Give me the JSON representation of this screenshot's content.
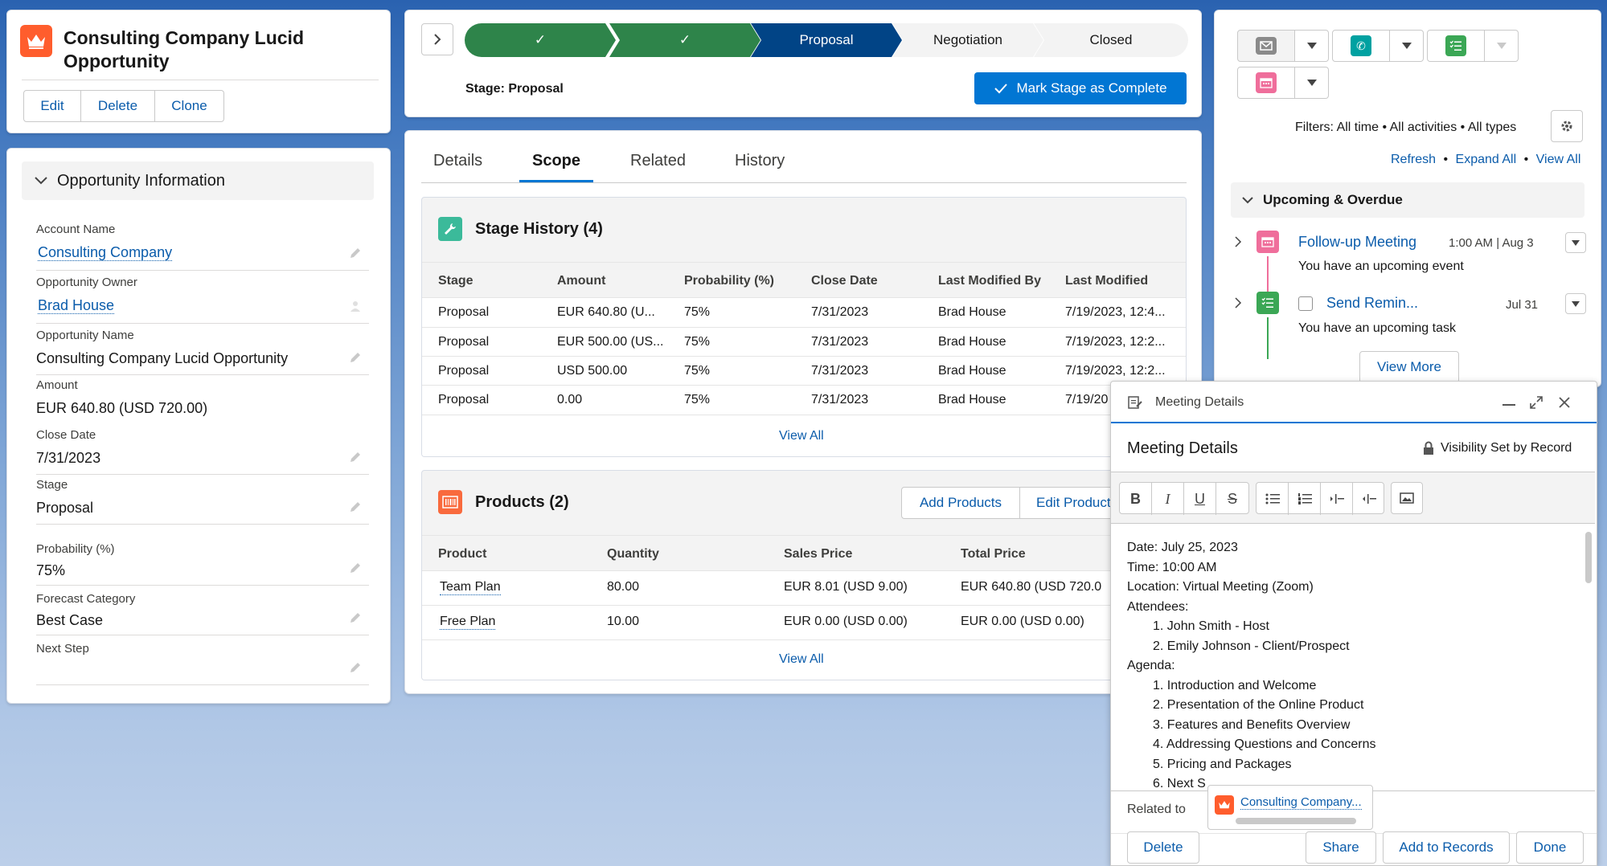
{
  "header": {
    "title_line1": "Consulting Company Lucid",
    "title_line2": "Opportunity",
    "edit": "Edit",
    "delete": "Delete",
    "clone": "Clone"
  },
  "info": {
    "section_title": "Opportunity Information",
    "fields": [
      {
        "label": "Account Name",
        "value": "Consulting Company"
      },
      {
        "label": "Opportunity Owner",
        "value": "Brad House"
      },
      {
        "label": "Opportunity Name",
        "value": "Consulting Company Lucid Opportunity"
      },
      {
        "label": "Amount",
        "value": "EUR 640.80 (USD 720.00)"
      },
      {
        "label": "Close Date",
        "value": "7/31/2023"
      },
      {
        "label": "Stage",
        "value": "Proposal"
      },
      {
        "label": "Probability (%)",
        "value": "75%"
      },
      {
        "label": "Forecast Category",
        "value": "Best Case"
      },
      {
        "label": "Next Step",
        "value": ""
      }
    ]
  },
  "path": {
    "steps": [
      "✓",
      "✓",
      "Proposal",
      "Negotiation",
      "Closed"
    ],
    "stage_label": "Stage: Proposal",
    "mark_complete": "Mark Stage as Complete"
  },
  "tabs": [
    "Details",
    "Scope",
    "Related",
    "History"
  ],
  "stage_history": {
    "title": "Stage History (4)",
    "columns": [
      "Stage",
      "Amount",
      "Probability (%)",
      "Close Date",
      "Last Modified By",
      "Last Modified"
    ],
    "rows": [
      [
        "Proposal",
        "EUR 640.80 (U...",
        "75%",
        "7/31/2023",
        "Brad House",
        "7/19/2023, 12:4..."
      ],
      [
        "Proposal",
        "EUR 500.00 (US...",
        "75%",
        "7/31/2023",
        "Brad House",
        "7/19/2023, 12:2..."
      ],
      [
        "Proposal",
        "USD 500.00",
        "75%",
        "7/31/2023",
        "Brad House",
        "7/19/2023, 12:2..."
      ],
      [
        "Proposal",
        "0.00",
        "75%",
        "7/31/2023",
        "Brad House",
        "7/19/20"
      ]
    ],
    "view_all": "View All"
  },
  "products": {
    "title": "Products (2)",
    "add": "Add Products",
    "edit": "Edit Product",
    "columns": [
      "Product",
      "Quantity",
      "Sales Price",
      "Total Price"
    ],
    "rows": [
      [
        "Team Plan",
        "80.00",
        "EUR 8.01 (USD 9.00)",
        "EUR 640.80 (USD 720.0"
      ],
      [
        "Free Plan",
        "10.00",
        "EUR 0.00 (USD 0.00)",
        "EUR 0.00 (USD 0.00)"
      ]
    ],
    "view_all": "View All"
  },
  "activity": {
    "filters": "Filters: All time • All activities • All types",
    "refresh": "Refresh",
    "expand_all": "Expand All",
    "view_all": "View All",
    "sep": "•",
    "section": "Upcoming & Overdue",
    "items": [
      {
        "title": "Follow-up Meeting",
        "date": "1:00 AM | Aug 3",
        "sub": "You have an upcoming event"
      },
      {
        "title": "Send Remin...",
        "date": "Jul 31",
        "sub": "You have an upcoming task"
      }
    ],
    "view_more": "View More"
  },
  "modal": {
    "header": "Meeting Details",
    "title": "Meeting Details",
    "visibility": "Visibility Set by Record",
    "toolbar": [
      "B",
      "I",
      "U",
      "S"
    ],
    "body_lines": [
      "Date: July 25, 2023",
      "Time: 10:00 AM",
      "Location: Virtual Meeting (Zoom)",
      "Attendees:"
    ],
    "attendees": [
      "1. John Smith - Host",
      "2. Emily Johnson - Client/Prospect"
    ],
    "agenda_label": "Agenda:",
    "agenda": [
      "1. Introduction and Welcome",
      "2. Presentation of the Online Product",
      "3. Features and Benefits Overview",
      "4. Addressing Questions and Concerns",
      "5. Pricing and Packages",
      "6. Next S"
    ],
    "related_label": "Related to",
    "related_value": "Consulting Company...",
    "delete": "Delete",
    "share": "Share",
    "add_to_records": "Add to Records",
    "done": "Done"
  },
  "colors": {
    "brand": "#0176d3",
    "path_done": "#2e844a",
    "path_current": "#014486",
    "opp_icon": "#ff5d2d",
    "products_icon": "#f96a3d",
    "history_icon": "#3bba9a",
    "event_icon": "#ef6e9b",
    "task_icon": "#3ba755",
    "call_icon": "#00a1a1"
  }
}
